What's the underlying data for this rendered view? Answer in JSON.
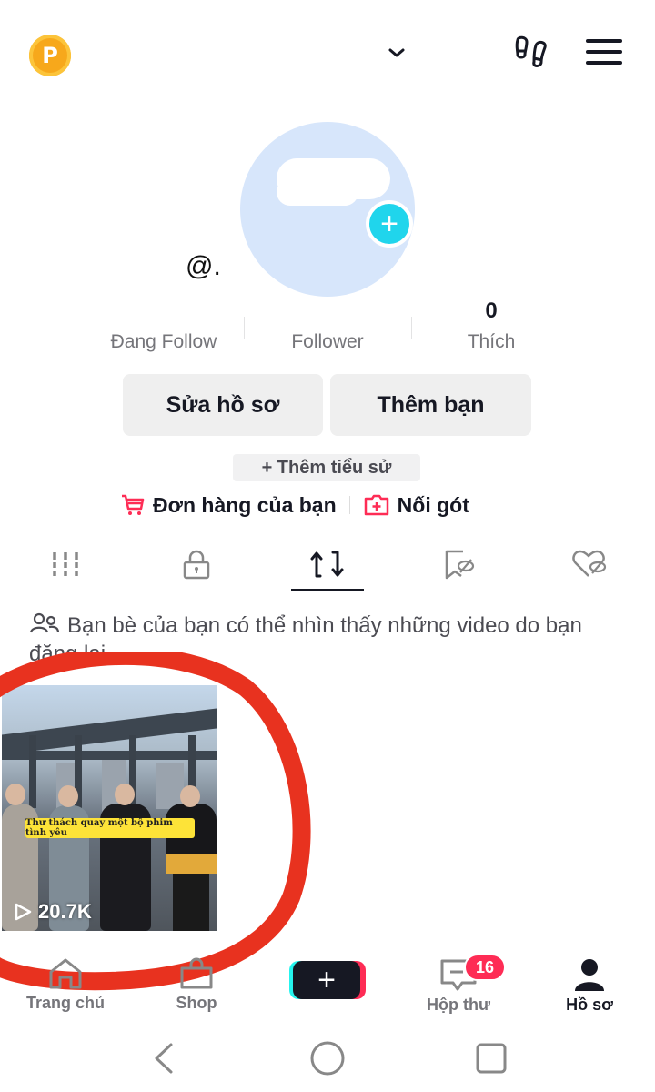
{
  "header": {
    "coin_letter": "P",
    "account_dropdown_icon": "chevron-down-icon",
    "footprint_icon": "footprints-icon",
    "menu_icon": "hamburger-menu-icon"
  },
  "profile": {
    "handle": "@.",
    "add_avatar_symbol": "+",
    "stats": [
      {
        "value": "",
        "label": "Đang Follow"
      },
      {
        "value": "",
        "label": "Follower"
      },
      {
        "value": "0",
        "label": "Thích"
      }
    ],
    "edit_button": "Sửa hồ sơ",
    "add_friend_button": "Thêm bạn",
    "add_bio": "+ Thêm tiểu sử",
    "orders_link": "Đơn hàng của bạn",
    "second_link": "Nối gót"
  },
  "tabs": [
    {
      "name": "videos",
      "icon": "grid-icon",
      "active": false
    },
    {
      "name": "private",
      "icon": "lock-icon",
      "active": false
    },
    {
      "name": "reposts",
      "icon": "repost-icon",
      "active": true
    },
    {
      "name": "favorites",
      "icon": "bookmark-hidden-icon",
      "active": false
    },
    {
      "name": "liked",
      "icon": "heart-hidden-icon",
      "active": false
    }
  ],
  "repost_notice": "Bạn bè của bạn có thể nhìn thấy những video do bạn đăng lại",
  "videos": [
    {
      "caption": "Thư thách quay một bộ phim tình yêu",
      "views": "20.7K"
    }
  ],
  "bottom_nav": [
    {
      "label": "Trang chủ",
      "icon": "home-icon"
    },
    {
      "label": "Shop",
      "icon": "shop-icon"
    },
    {
      "label": "",
      "icon": "create-plus-icon"
    },
    {
      "label": "Hộp thư",
      "icon": "inbox-icon",
      "badge": "16"
    },
    {
      "label": "Hồ sơ",
      "icon": "profile-icon",
      "active": true
    }
  ],
  "create_symbol": "+",
  "colors": {
    "accent": "#fe2c55",
    "cyan": "#25f4ee",
    "avatar_bg": "#d7e6fb",
    "annotation_red": "#e8321f"
  }
}
